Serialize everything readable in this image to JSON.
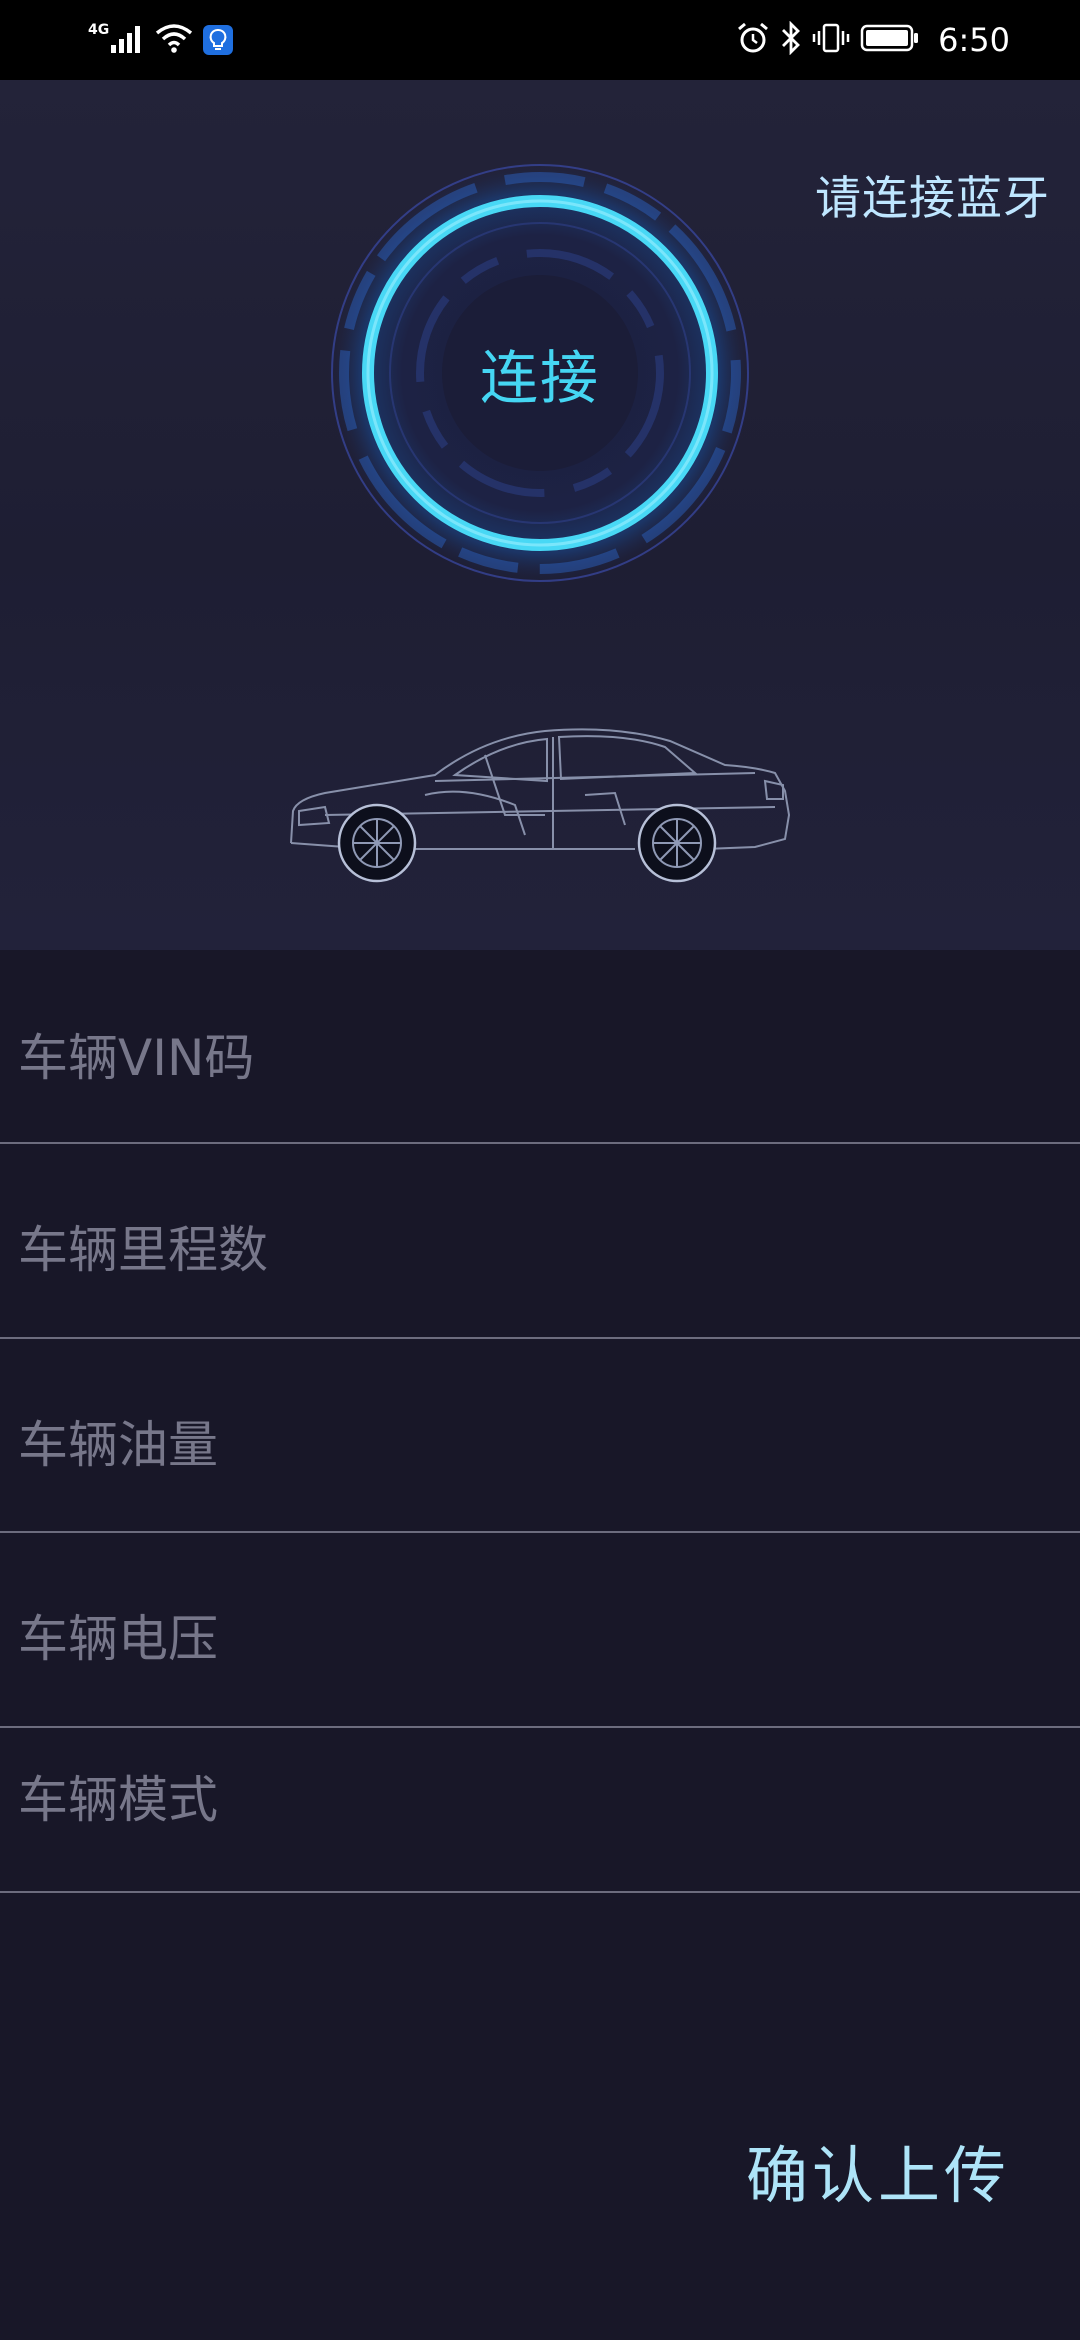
{
  "status_bar": {
    "network": "4G",
    "time": "6:50",
    "icons": [
      "signal-icon",
      "wifi-icon",
      "lightbulb-icon",
      "alarm-icon",
      "bluetooth-icon",
      "vibrate-icon",
      "battery-icon"
    ]
  },
  "hero": {
    "bluetooth_hint": "请连接蓝牙",
    "connect_label": "连接"
  },
  "vehicle_fields": [
    {
      "label": "车辆VIN码"
    },
    {
      "label": "车辆里程数"
    },
    {
      "label": "车辆油量"
    },
    {
      "label": "车辆电压"
    },
    {
      "label": "车辆模式"
    }
  ],
  "actions": {
    "upload_label": "确认上传"
  },
  "colors": {
    "background": "#181728",
    "accent_cyan": "#45d6f3",
    "hint_text": "#bfe6ff",
    "field_label": "#77778a",
    "divider": "#6c6c7e"
  }
}
